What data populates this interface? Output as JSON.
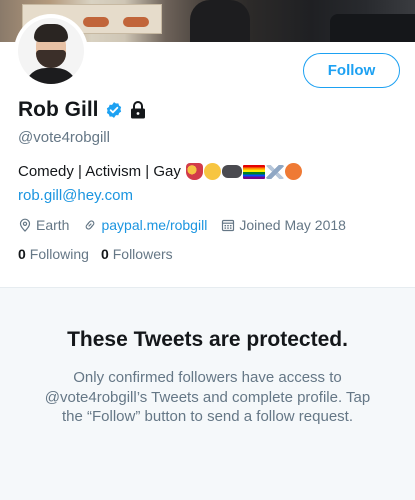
{
  "profile": {
    "name": "Rob Gill",
    "handle": "@vote4robgill",
    "bio_text": "Comedy | Activism | Gay",
    "bio_emojis": [
      "performing-arts",
      "face-with-tears-of-joy",
      "video-game",
      "rainbow-flag",
      "airplane",
      "face-with-symbols-on-mouth"
    ],
    "email": "rob.gill@hey.com",
    "location": "Earth",
    "website": "paypal.me/robgill",
    "joined": "Joined May 2018",
    "following_count": "0",
    "following_label": "Following",
    "followers_count": "0",
    "followers_label": "Followers",
    "verified": true,
    "protected": true
  },
  "actions": {
    "follow_label": "Follow"
  },
  "protected_notice": {
    "title": "These Tweets are protected.",
    "body": "Only confirmed followers have access to @vote4robgill’s Tweets and complete profile. Tap the “Follow” button to send a follow request."
  },
  "icons": {
    "location": "location-pin-icon",
    "link": "link-icon",
    "calendar": "calendar-icon",
    "verified": "verified-badge-icon",
    "lock": "lock-icon"
  },
  "colors": {
    "accent": "#1da1f2",
    "link": "#1b95e0",
    "text": "#14171a",
    "secondary": "#657786",
    "panel": "#f5f8fa"
  }
}
